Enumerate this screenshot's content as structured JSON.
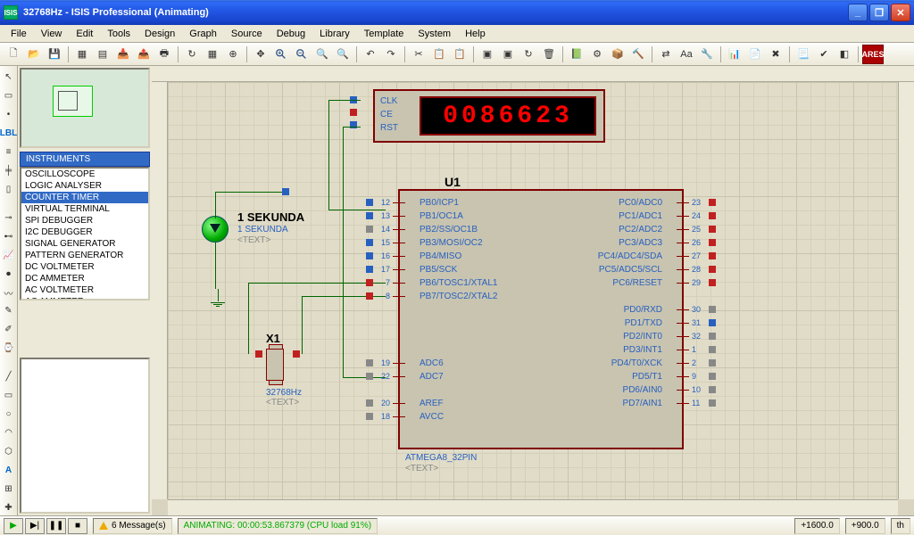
{
  "title": "32768Hz - ISIS Professional (Animating)",
  "menus": [
    "File",
    "View",
    "Edit",
    "Tools",
    "Design",
    "Graph",
    "Source",
    "Debug",
    "Library",
    "Template",
    "System",
    "Help"
  ],
  "instruments_header": "INSTRUMENTS",
  "instruments": [
    "OSCILLOSCOPE",
    "LOGIC ANALYSER",
    "COUNTER TIMER",
    "VIRTUAL TERMINAL",
    "SPI DEBUGGER",
    "I2C DEBUGGER",
    "SIGNAL GENERATOR",
    "PATTERN GENERATOR",
    "DC VOLTMETER",
    "DC AMMETER",
    "AC VOLTMETER",
    "AC AMMETER"
  ],
  "instruments_selected_index": 2,
  "counter": {
    "pins": [
      "CLK",
      "CE",
      "RST"
    ],
    "display": "0086623"
  },
  "led": {
    "ref": "1 SEKUNDA",
    "value": "1 SEKUNDA",
    "text": "<TEXT>"
  },
  "xtal": {
    "ref": "X1",
    "freq": "32768Hz",
    "text": "<TEXT>"
  },
  "chip": {
    "ref": "U1",
    "part": "ATMEGA8_32PIN",
    "text": "<TEXT>",
    "left_pins": [
      {
        "num": "12",
        "name": "PB0/ICP1",
        "sq": "blue"
      },
      {
        "num": "13",
        "name": "PB1/OC1A",
        "sq": "blue",
        "oc": "OC1A"
      },
      {
        "num": "14",
        "name": "PB2/SS/OC1B",
        "sq": "gray"
      },
      {
        "num": "15",
        "name": "PB3/MOSI/OC2",
        "sq": "blue"
      },
      {
        "num": "16",
        "name": "PB4/MISO",
        "sq": "blue"
      },
      {
        "num": "17",
        "name": "PB5/SCK",
        "sq": "blue"
      },
      {
        "num": "7",
        "name": "PB6/TOSC1/XTAL1",
        "sq": "red"
      },
      {
        "num": "8",
        "name": "PB7/TOSC2/XTAL2",
        "sq": "red"
      },
      {
        "num": "",
        "name": ""
      },
      {
        "num": "",
        "name": ""
      },
      {
        "num": "",
        "name": ""
      },
      {
        "num": "",
        "name": ""
      },
      {
        "num": "19",
        "name": "ADC6",
        "sq": "gray"
      },
      {
        "num": "22",
        "name": "ADC7",
        "sq": "gray"
      },
      {
        "num": "",
        "name": ""
      },
      {
        "num": "20",
        "name": "AREF",
        "sq": "gray"
      },
      {
        "num": "18",
        "name": "AVCC",
        "sq": "gray"
      }
    ],
    "right_pins": [
      {
        "num": "23",
        "name": "PC0/ADC0",
        "sq": "red"
      },
      {
        "num": "24",
        "name": "PC1/ADC1",
        "sq": "red"
      },
      {
        "num": "25",
        "name": "PC2/ADC2",
        "sq": "red"
      },
      {
        "num": "26",
        "name": "PC3/ADC3",
        "sq": "red"
      },
      {
        "num": "27",
        "name": "PC4/ADC4/SDA",
        "sq": "red"
      },
      {
        "num": "28",
        "name": "PC5/ADC5/SCL",
        "sq": "red"
      },
      {
        "num": "29",
        "name": "PC6/RESET",
        "sq": "red",
        "oc": "RESET"
      },
      {
        "num": "",
        "name": ""
      },
      {
        "num": "30",
        "name": "PD0/RXD",
        "sq": "gray"
      },
      {
        "num": "31",
        "name": "PD1/TXD",
        "sq": "blue"
      },
      {
        "num": "32",
        "name": "PD2/INT0",
        "sq": "gray"
      },
      {
        "num": "1",
        "name": "PD3/INT1",
        "sq": "gray"
      },
      {
        "num": "2",
        "name": "PD4/T0/XCK",
        "sq": "gray"
      },
      {
        "num": "9",
        "name": "PD5/T1",
        "sq": "gray"
      },
      {
        "num": "10",
        "name": "PD6/AIN0",
        "sq": "gray"
      },
      {
        "num": "11",
        "name": "PD7/AIN1",
        "sq": "gray"
      }
    ]
  },
  "sim": {
    "messages": "6 Message(s)",
    "animating": "ANIMATING: 00:00:53.867379 (CPU load 91%)",
    "coord_x": "+1600.0",
    "coord_y": "+900.0",
    "units": "th"
  }
}
